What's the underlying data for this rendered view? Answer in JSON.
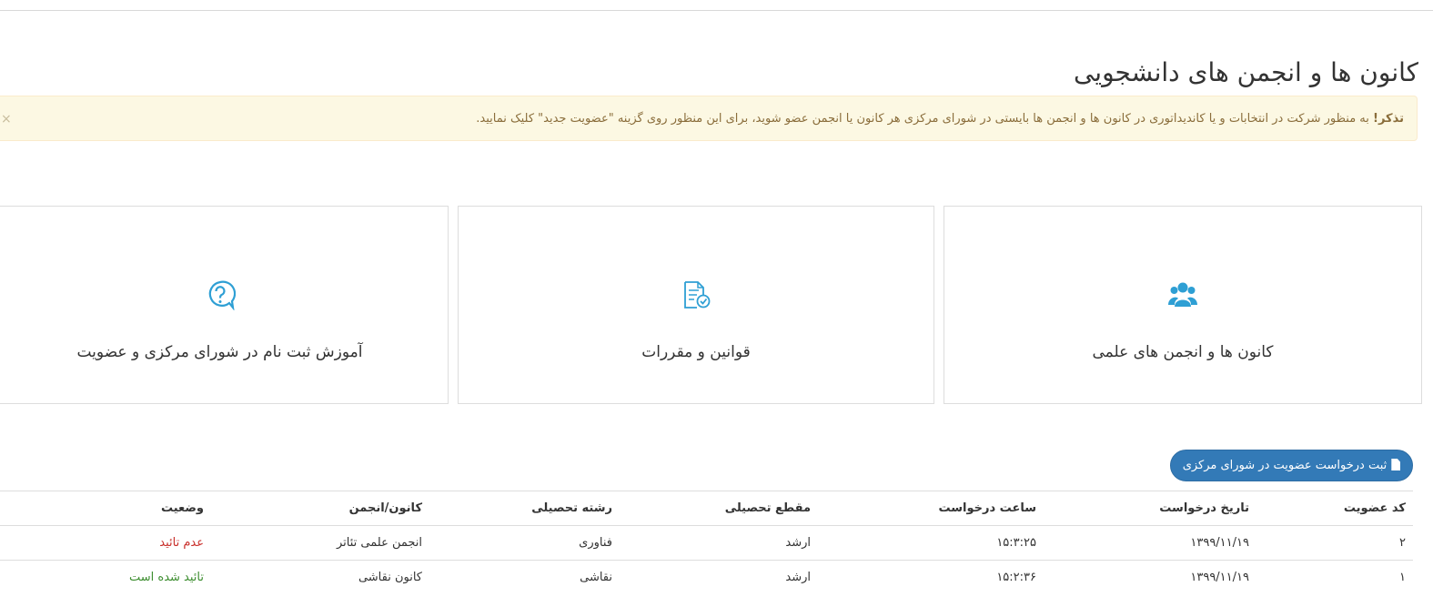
{
  "page": {
    "title": "کانون ها و انجمن های دانشجویی"
  },
  "alert": {
    "strong": "تذکر!",
    "text": " به منظور شرکت در انتخابات و یا کاندیداتوری در کانون ها و انجمن ها بایستی در شورای مرکزی هر کانون یا انجمن عضو شوید، برای این منظور روی گزینه \"عضویت جدید\" کلیک نمایید.",
    "close": "×"
  },
  "cards": [
    {
      "label": "کانون ها و انجمن های علمی",
      "icon": "users-icon"
    },
    {
      "label": "قوانین و مقررات",
      "icon": "document-check-icon"
    },
    {
      "label": "آموزش ثبت نام در شورای مرکزی و عضویت",
      "icon": "question-chat-icon"
    }
  ],
  "colors": {
    "accent": "#2e9fd4",
    "primary_button": "#337ab7",
    "alert_bg": "#fcf8e3",
    "rejected": "#c9302c",
    "approved": "#3c8d2f"
  },
  "actions": {
    "register_button": "ثبت درخواست عضویت در شورای مرکزی"
  },
  "table": {
    "headers": [
      "کد عضویت",
      "تاریخ درخواست",
      "ساعت درخواست",
      "مقطع تحصیلی",
      "رشته تحصیلی",
      "کانون/انجمن",
      "وضعیت"
    ],
    "rows": [
      [
        "۲",
        "۱۳۹۹/۱۱/۱۹",
        "۱۵:۳:۲۵",
        "ارشد",
        "فناوری",
        "انجمن علمی تئاتر",
        "عدم تائید"
      ],
      [
        "۱",
        "۱۳۹۹/۱۱/۱۹",
        "۱۵:۲:۳۶",
        "ارشد",
        "نقاشی",
        "کانون نقاشی",
        "تائید شده است"
      ]
    ]
  }
}
